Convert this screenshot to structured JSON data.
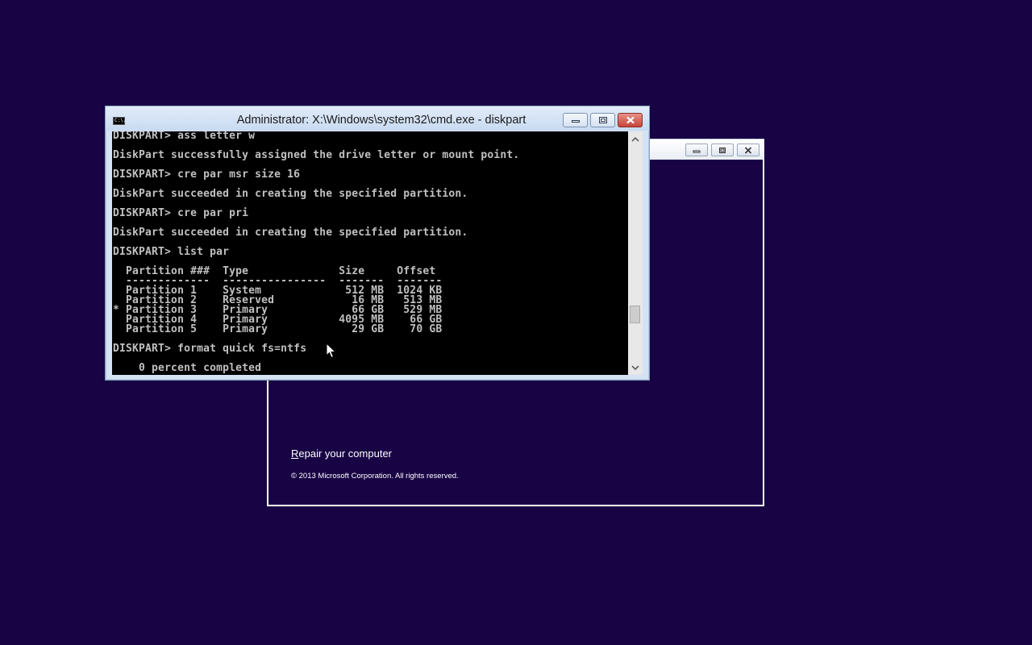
{
  "setup_window": {
    "repair_link": {
      "accel": "R",
      "rest": "epair your computer"
    },
    "copyright": "© 2013 Microsoft Corporation. All rights reserved."
  },
  "cmd_window": {
    "title": "Administrator: X:\\Windows\\system32\\cmd.exe - diskpart",
    "icon_text": "C:\\.",
    "console_lines": [
      "DISKPART> ass letter w",
      "",
      "DiskPart successfully assigned the drive letter or mount point.",
      "",
      "DISKPART> cre par msr size 16",
      "",
      "DiskPart succeeded in creating the specified partition.",
      "",
      "DISKPART> cre par pri",
      "",
      "DiskPart succeeded in creating the specified partition.",
      "",
      "DISKPART> list par",
      "",
      "  Partition ###  Type              Size     Offset",
      "  -------------  ----------------  -------  -------",
      "  Partition 1    System             512 MB  1024 KB",
      "  Partition 2    Reserved            16 MB   513 MB",
      "* Partition 3    Primary             66 GB   529 MB",
      "  Partition 4    Primary           4095 MB    66 GB",
      "  Partition 5    Primary             29 GB    70 GB",
      "",
      "DISKPART> format quick fs=ntfs",
      "",
      "    0 percent completed"
    ]
  },
  "icons": {
    "minimize": "minimize-icon",
    "maximize": "maximize-icon",
    "close": "close-icon",
    "scroll_up": "chevron-up-icon",
    "scroll_down": "chevron-down-icon",
    "pointer": "mouse-pointer-icon"
  },
  "colors": {
    "desktop_bg": "#180345",
    "console_bg": "#000000",
    "console_text": "#c0c0c0",
    "close_button": "#c8443a"
  }
}
